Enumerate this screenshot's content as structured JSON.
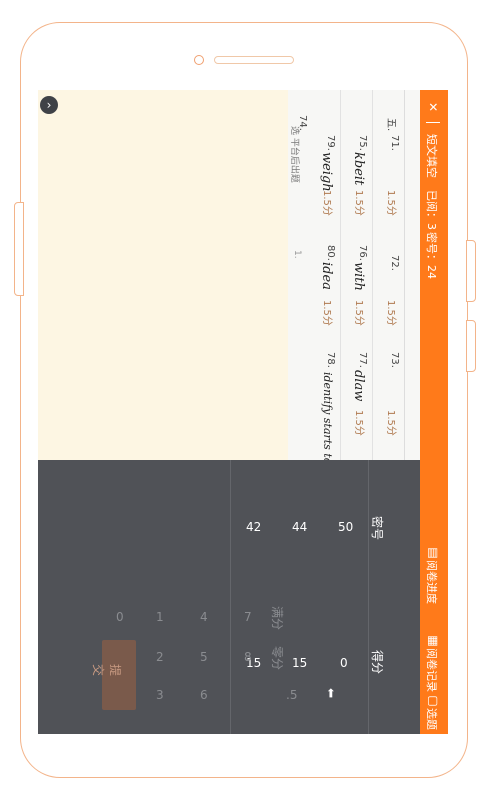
{
  "sidebar": {
    "close_glyph": "✕",
    "title": "短文填空",
    "marked": "已阅：3",
    "seal": "密号：24",
    "progress": "阅卷进度",
    "records": "阅卷记录",
    "sample": "选题"
  },
  "paper": {
    "section": "五.",
    "numbers": [
      "71.",
      "72.",
      "73.",
      "74.",
      "75.",
      "76.",
      "77.",
      "78.",
      "79.",
      "80."
    ],
    "score_tag": "1.5分",
    "answers": [
      "kbeit",
      "with",
      "dlaw",
      "weigh",
      "idea",
      "identify starts together"
    ],
    "footer_line": "1.",
    "note": "选 平台后出题"
  },
  "grading": {
    "col_seal": "密号",
    "col_score": "得分",
    "rows": [
      {
        "seal": "50",
        "score": "0"
      },
      {
        "seal": "44",
        "score": "15"
      },
      {
        "seal": "42",
        "score": "15"
      }
    ],
    "digits": [
      "1",
      "2",
      "3",
      "4",
      "5",
      "6",
      "7",
      "8",
      "0"
    ],
    "full_marks": "满分",
    "zero_marks": "零分",
    "half_point": ".5",
    "backspace": "⬅",
    "submit": "提交"
  },
  "colors": {
    "accent": "#ff7a1a",
    "keypad": "#505257",
    "sheet": "#fdf6e3"
  }
}
